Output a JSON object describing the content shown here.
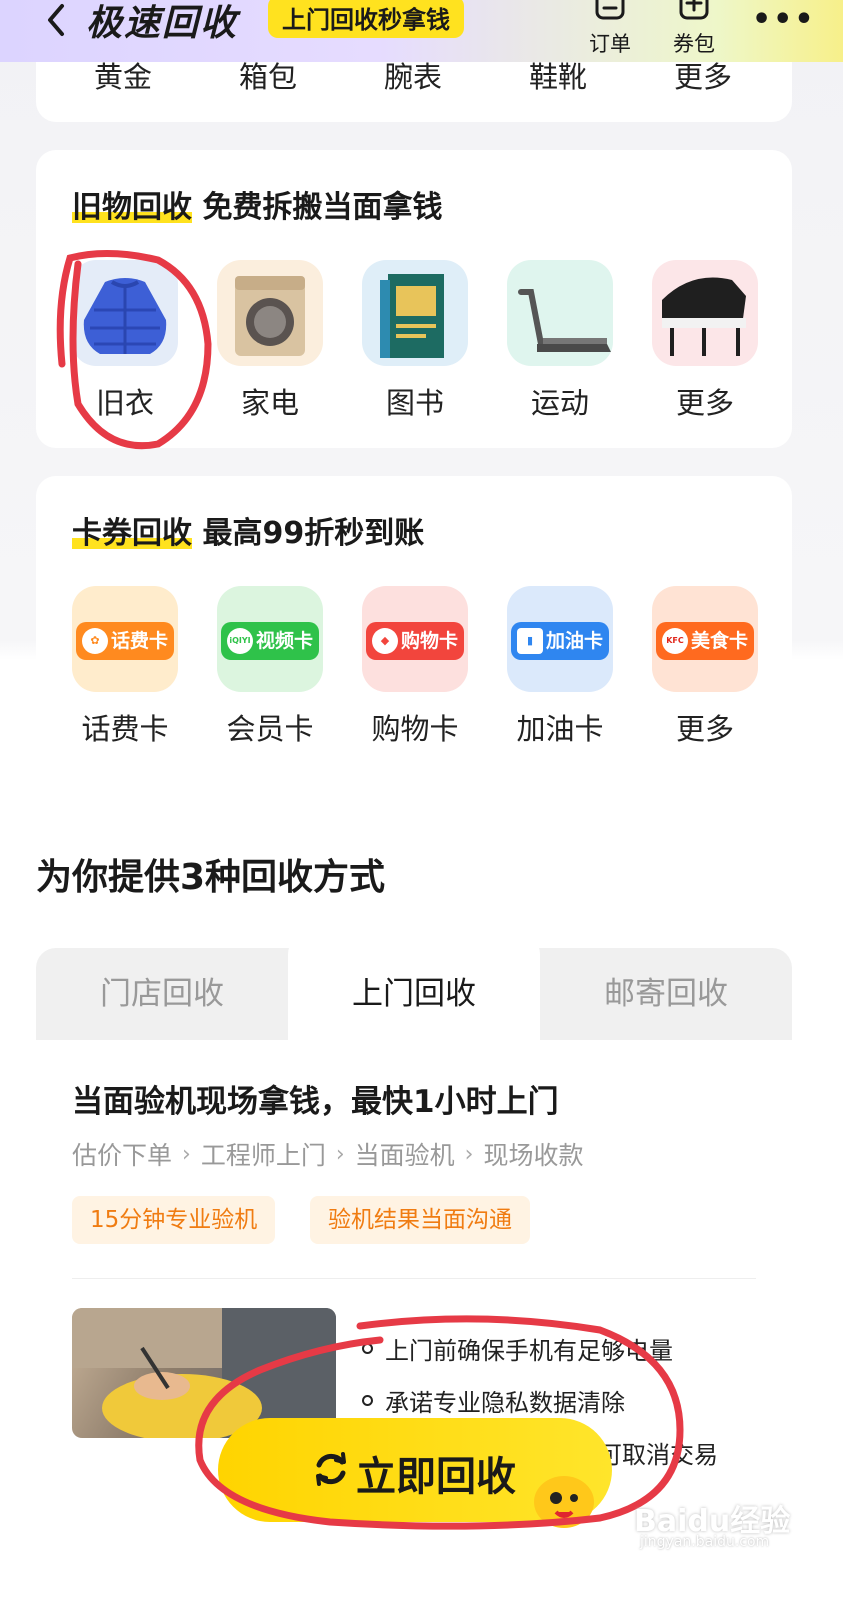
{
  "header": {
    "title": "极速回收",
    "badge": "上门回收秒拿钱",
    "actions": [
      {
        "label": "订单",
        "icon": "order-icon"
      },
      {
        "label": "券包",
        "icon": "coupon-icon"
      }
    ],
    "more": "•••"
  },
  "top_categories": [
    "黄金",
    "箱包",
    "腕表",
    "鞋靴",
    "更多"
  ],
  "used_goods": {
    "title_highlight": "旧物回收",
    "title_rest": "免费拆搬当面拿钱",
    "items": [
      {
        "label": "旧衣",
        "icon": "jacket-icon"
      },
      {
        "label": "家电",
        "icon": "washing-machine-icon"
      },
      {
        "label": "图书",
        "icon": "book-icon"
      },
      {
        "label": "运动",
        "icon": "treadmill-icon"
      },
      {
        "label": "更多",
        "icon": "piano-icon"
      }
    ]
  },
  "card_voucher": {
    "title_highlight": "卡券回收",
    "title_rest": "最高99折秒到账",
    "items": [
      {
        "label": "话费卡",
        "card_text": "话费卡",
        "color": "#ff8a1f"
      },
      {
        "label": "会员卡",
        "card_text": "视频卡",
        "color": "#2fc24a"
      },
      {
        "label": "购物卡",
        "card_text": "购物卡",
        "color": "#f2453d"
      },
      {
        "label": "加油卡",
        "card_text": "加油卡",
        "color": "#2f86f0"
      },
      {
        "label": "更多",
        "card_text": "美食卡",
        "color": "#ff6a1f"
      }
    ],
    "logos": [
      "",
      "iQIYI",
      "",
      "",
      "KFC"
    ]
  },
  "methods_heading": "为你提供3种回收方式",
  "tabs": [
    {
      "label": "门店回收",
      "active": false
    },
    {
      "label": "上门回收",
      "active": true
    },
    {
      "label": "邮寄回收",
      "active": false
    }
  ],
  "door": {
    "title": "当面验机现场拿钱，最快1小时上门",
    "steps": [
      "估价下单",
      "工程师上门",
      "当面验机",
      "现场收款"
    ],
    "step_separator": "›",
    "tags": [
      "15分钟专业验机",
      "验机结果当面沟通"
    ],
    "bullets": [
      "上门前确保手机有足够电量",
      "承诺专业隐私数据清除",
      "可取消交易"
    ]
  },
  "cta": {
    "label": "立即回收"
  },
  "watermark": {
    "main": "Baidu经验",
    "sub": "jingyan.baidu.com"
  },
  "colors": {
    "accent_yellow": "#ffe21f",
    "annotation_red": "#e63a46",
    "tag_orange": "#f07c12"
  }
}
